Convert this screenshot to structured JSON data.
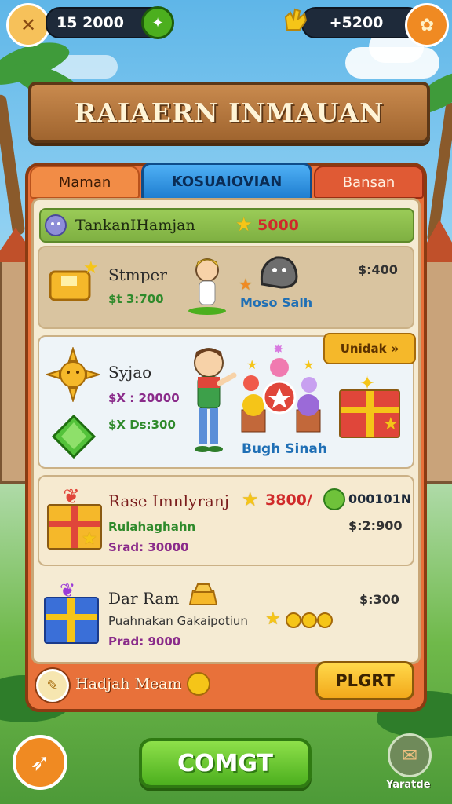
{
  "top_bar": {
    "left_value": "15 2000",
    "right_value": "+5200"
  },
  "title": "RAIAERN INMAUAN",
  "tabs": [
    {
      "label": "Maman"
    },
    {
      "label": "KOSUAIOVIAN"
    },
    {
      "label": "Bansan"
    }
  ],
  "section": {
    "label": "TankanIHamjan",
    "value": "5000"
  },
  "cards": [
    {
      "name": "Stmper",
      "value": "$t 3:700",
      "price": "$:400",
      "item_label": "Moso Salh"
    },
    {
      "name": "Syjao",
      "value1": "$X : 20000",
      "value2": "$X Ds:300",
      "badge": "Unidak",
      "badge_arrow": "»",
      "item_label": "Bugh Sinah"
    },
    {
      "name": "Rase Imnlyranj",
      "star_value": "3800/",
      "coin_value": "000101N",
      "sub1": "Rulahaghahn",
      "sub2": "Srad: 30000",
      "price": "$:2:900"
    },
    {
      "name": "Dar Ram",
      "sub1": "Puahnakan Gakaipotiun",
      "sub2": "Prad: 9000",
      "price": "$:300"
    }
  ],
  "footer": {
    "label": "Hadjah Meam",
    "button": "PLGRT"
  },
  "bottom": {
    "main_button": "COMGT",
    "right_label": "Yaratde"
  },
  "colors": {
    "panel_orange": "#e8713a",
    "active_tab": "#2f8fe0",
    "section_green": "#8fbf4d",
    "gold": "#f5c518"
  },
  "icons": [
    "close-icon",
    "plus-icon",
    "leaf-coin-icon",
    "hand-icon",
    "star-icon",
    "gift-icon",
    "gem-icon",
    "sun-icon",
    "coin-icon",
    "rocket-icon",
    "bag-icon"
  ]
}
